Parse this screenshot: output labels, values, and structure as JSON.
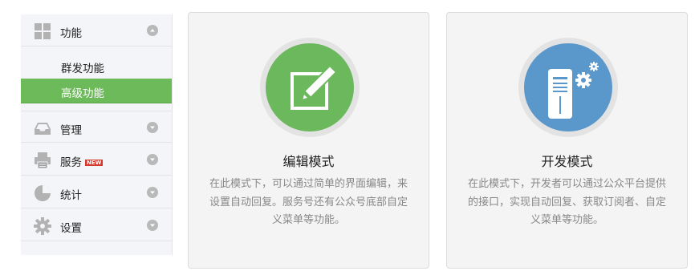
{
  "sidebar": {
    "items": [
      {
        "label": "功能",
        "icon": "grid-icon",
        "expanded": true
      },
      {
        "label": "管理",
        "icon": "inbox-icon"
      },
      {
        "label": "服务",
        "icon": "printer-icon",
        "badge": "NEW"
      },
      {
        "label": "统计",
        "icon": "pie-chart-icon"
      },
      {
        "label": "设置",
        "icon": "gear-icon"
      }
    ],
    "subitems": [
      {
        "label": "群发功能"
      },
      {
        "label": "高级功能",
        "active": true
      }
    ]
  },
  "cards": [
    {
      "title": "编辑模式",
      "description": "在此模式下，可以通过简单的界面编辑，来设置自动回复。服务号还有公众号底部自定义菜单等功能。",
      "icon": "edit-icon",
      "color": "#6cb85d"
    },
    {
      "title": "开发模式",
      "description": "在此模式下，开发者可以通过公众平台提供的接口，实现自动回复、获取订阅者、自定义菜单等功能。",
      "icon": "server-gear-icon",
      "color": "#5a98cc"
    }
  ],
  "colors": {
    "accent_green": "#6cba59",
    "accent_blue": "#5a98cc",
    "badge_red": "#d5382a"
  }
}
